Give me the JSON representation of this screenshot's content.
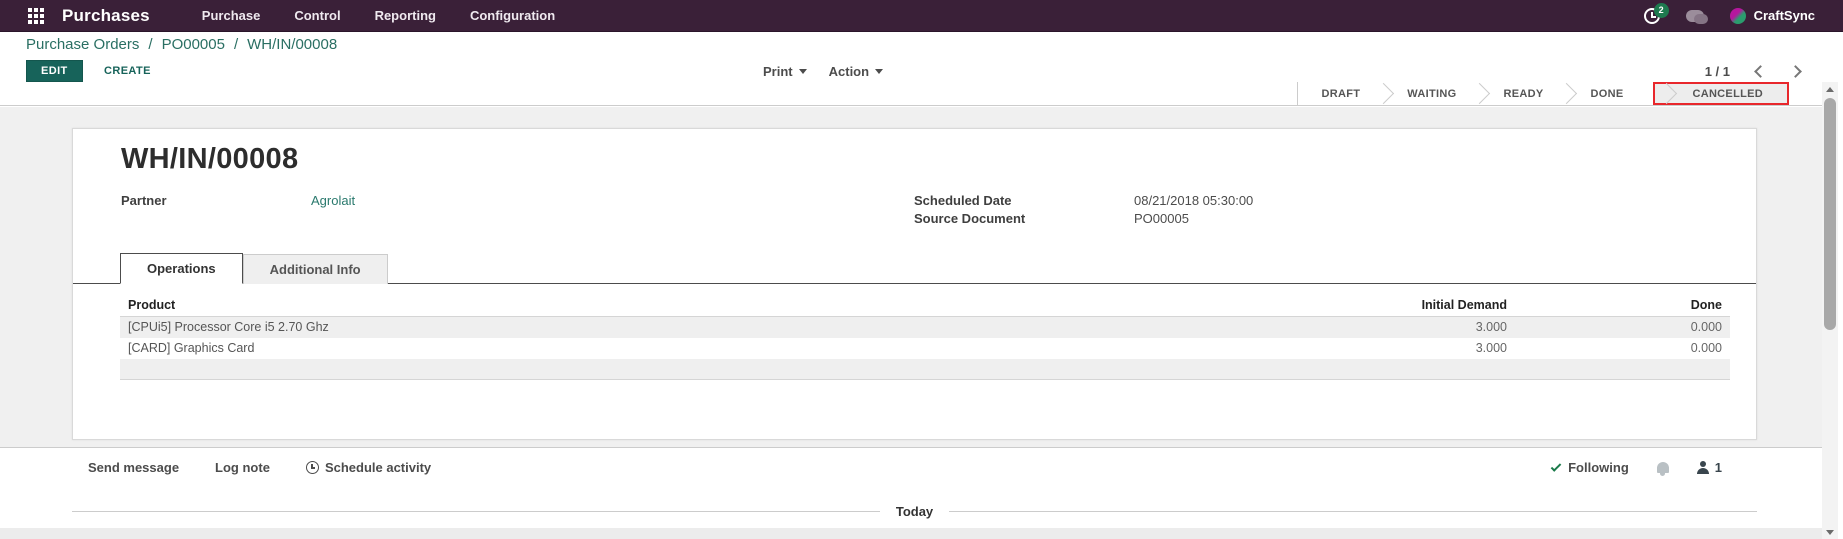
{
  "navbar": {
    "brand": "Purchases",
    "menu": [
      "Purchase",
      "Control",
      "Reporting",
      "Configuration"
    ],
    "activity_badge": "2",
    "user": "CraftSync"
  },
  "breadcrumb": {
    "separator": "/",
    "items": [
      "Purchase Orders",
      "PO00005",
      "WH/IN/00008"
    ]
  },
  "actions": {
    "edit": "EDIT",
    "create": "CREATE",
    "print": "Print",
    "action": "Action",
    "pager": "1 / 1"
  },
  "statusbar": {
    "steps": [
      {
        "label": "DRAFT"
      },
      {
        "label": "WAITING"
      },
      {
        "label": "READY"
      },
      {
        "label": "DONE"
      },
      {
        "label": "CANCELLED",
        "highlighted": true
      }
    ]
  },
  "document": {
    "title": "WH/IN/00008",
    "fields_left": [
      {
        "label": "Partner",
        "value": "Agrolait"
      }
    ],
    "fields_right": [
      {
        "label": "Scheduled Date",
        "value": "08/21/2018 05:30:00"
      },
      {
        "label": "Source Document",
        "value": "PO00005"
      }
    ],
    "tabs": [
      {
        "label": "Operations",
        "active": true
      },
      {
        "label": "Additional Info",
        "active": false
      }
    ],
    "table": {
      "columns": [
        "Product",
        "Initial Demand",
        "Done"
      ],
      "rows": [
        {
          "product": "[CPUi5] Processor Core i5 2.70 Ghz",
          "initial_demand": "3.000",
          "done": "0.000"
        },
        {
          "product": "[CARD] Graphics Card",
          "initial_demand": "3.000",
          "done": "0.000"
        }
      ]
    }
  },
  "chatter": {
    "send_message": "Send message",
    "log_note": "Log note",
    "schedule_activity": "Schedule activity",
    "following": "Following",
    "follower_count": "1",
    "divider": "Today"
  },
  "colors": {
    "navbar_bg": "#3a2038",
    "accent_teal": "#17635a",
    "link_teal": "#2a796d",
    "highlight_red": "#e8272c",
    "badge_green": "#1e7a4f"
  }
}
